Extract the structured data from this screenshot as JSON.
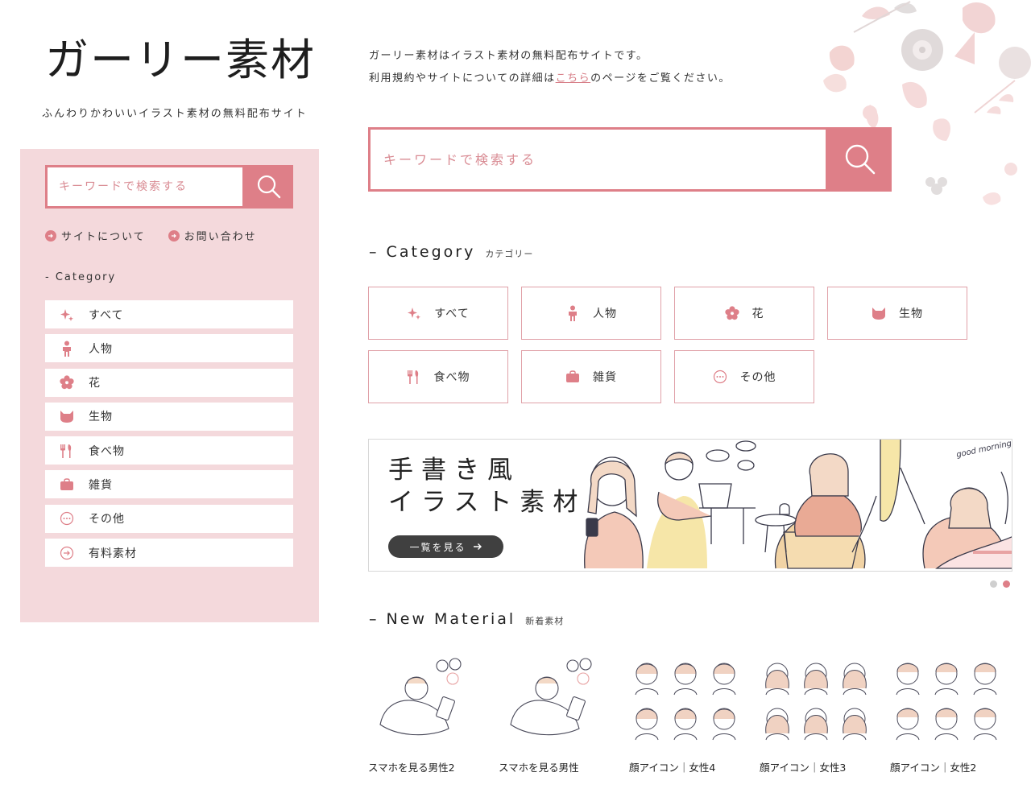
{
  "site": {
    "logo": "ガーリー素材",
    "tagline": "ふんわりかわいいイラスト素材の無料配布サイト",
    "intro_line1": "ガーリー素材はイラスト素材の無料配布サイトです。",
    "intro_line2_pre": "利用規約やサイトについての詳細は",
    "intro_link": "こちら",
    "intro_line2_post": "のページをご覧ください。"
  },
  "sidebar": {
    "search_placeholder": "キーワードで検索する",
    "links": [
      "サイトについて",
      "お問い合わせ"
    ],
    "category_title": "- Category",
    "items": [
      {
        "label": "すべて",
        "icon": "sparkle-icon"
      },
      {
        "label": "人物",
        "icon": "person-icon"
      },
      {
        "label": "花",
        "icon": "flower-icon"
      },
      {
        "label": "生物",
        "icon": "cat-icon"
      },
      {
        "label": "食べ物",
        "icon": "cutlery-icon"
      },
      {
        "label": "雑貨",
        "icon": "bag-icon"
      },
      {
        "label": "その他",
        "icon": "ellipsis-circle-icon"
      },
      {
        "label": "有料素材",
        "icon": "arrow-circle-icon"
      }
    ]
  },
  "main": {
    "search_placeholder": "キーワードで検索する",
    "category": {
      "title_en": "Category",
      "title_ja": "カテゴリー",
      "items": [
        {
          "label": "すべて",
          "icon": "sparkle-icon"
        },
        {
          "label": "人物",
          "icon": "person-icon"
        },
        {
          "label": "花",
          "icon": "flower-icon"
        },
        {
          "label": "生物",
          "icon": "cat-icon"
        },
        {
          "label": "食べ物",
          "icon": "cutlery-icon"
        },
        {
          "label": "雑貨",
          "icon": "bag-icon"
        },
        {
          "label": "その他",
          "icon": "ellipsis-circle-icon"
        }
      ]
    },
    "banner": {
      "title_line1": "手書き風",
      "title_line2": "イラスト素材",
      "button": "一覧を見る",
      "art_text": "good morning!"
    },
    "new_material": {
      "title_en": "New Material",
      "title_ja": "新着素材",
      "items": [
        {
          "caption": "スマホを見る男性2"
        },
        {
          "caption": "スマホを見る男性"
        },
        {
          "caption": "顔アイコン｜女性4"
        },
        {
          "caption": "顔アイコン｜女性3"
        },
        {
          "caption": "顔アイコン｜女性2"
        }
      ]
    }
  },
  "colors": {
    "accent": "#de7f88",
    "sidebar_bg": "#f4d9dc",
    "text": "#333333",
    "banner_button": "#404040"
  }
}
